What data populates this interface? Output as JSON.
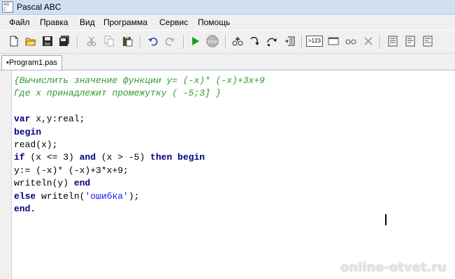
{
  "window": {
    "title": "Pascal ABC",
    "icon": "abc-app-icon"
  },
  "menu": [
    "Файл",
    "Правка",
    "Вид",
    "Программа",
    "Сервис",
    "Помощь"
  ],
  "toolbar": {
    "stop_label": "STOP",
    "step_label": ">123"
  },
  "tabs": [
    {
      "label": "•Program1.pas"
    }
  ],
  "code": {
    "lines": [
      [
        {
          "t": "{Вычислить значение функции у= (-х)* (-х)+3х+9",
          "c": "cmt"
        }
      ],
      [
        {
          "t": "Где х принадлежит промежутку ( -5;3] }",
          "c": "cmt"
        }
      ],
      [],
      [
        {
          "t": "var",
          "c": "kw"
        },
        {
          "t": " x,y:real;",
          "c": ""
        }
      ],
      [
        {
          "t": "begin",
          "c": "kw"
        }
      ],
      [
        {
          "t": "read(x);",
          "c": ""
        }
      ],
      [
        {
          "t": "if",
          "c": "kw"
        },
        {
          "t": " (x <= 3) ",
          "c": ""
        },
        {
          "t": "and",
          "c": "kw"
        },
        {
          "t": " (x > -5) ",
          "c": ""
        },
        {
          "t": "then begin",
          "c": "kw"
        }
      ],
      [
        {
          "t": "y:= (-x)* (-x)+3*x+9;",
          "c": ""
        }
      ],
      [
        {
          "t": "writeln(y) ",
          "c": ""
        },
        {
          "t": "end",
          "c": "kw"
        }
      ],
      [
        {
          "t": "else",
          "c": "kw"
        },
        {
          "t": " writeln(",
          "c": ""
        },
        {
          "t": "'ошибка'",
          "c": "str"
        },
        {
          "t": ");",
          "c": ""
        }
      ],
      [
        {
          "t": "end.",
          "c": "kw"
        }
      ]
    ]
  },
  "watermark": "online-otvet.ru",
  "colors": {
    "comment": "#2f9b2f",
    "keyword": "#000080",
    "string": "#1010ff",
    "titlebar": "#cfe0f3"
  }
}
